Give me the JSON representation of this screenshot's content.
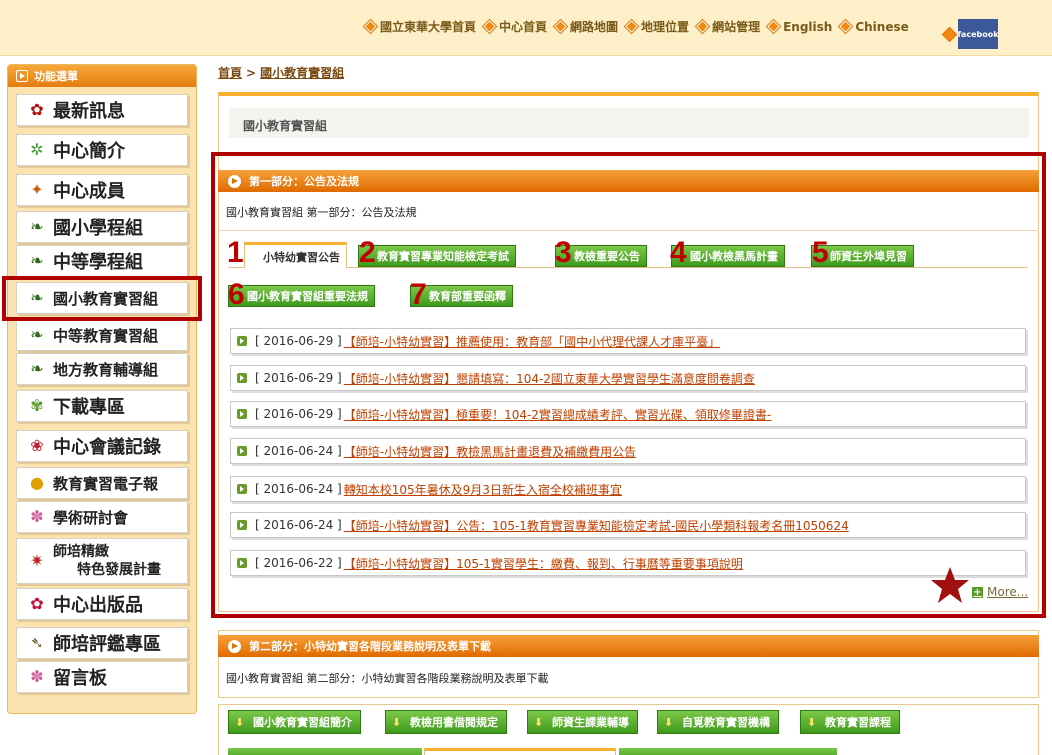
{
  "topbar": {
    "links": [
      "國立東華大學首頁",
      "中心首頁",
      "網路地圖",
      "地理位置",
      "網站管理",
      "English",
      "Chinese"
    ],
    "facebook_label": "facebook"
  },
  "sidebar": {
    "header": "功能選單",
    "items": [
      {
        "label": "最新訊息",
        "icon": "red-flower-icon"
      },
      {
        "label": "中心簡介",
        "icon": "green-flower-icon"
      },
      {
        "label": "中心成員",
        "icon": "bird-of-paradise-icon"
      },
      {
        "label": "國小學程組",
        "icon": "leaf-icon"
      },
      {
        "label": "中等學程組",
        "icon": "leaf-icon"
      },
      {
        "label": "國小教育實習組",
        "icon": "leaf-icon"
      },
      {
        "label": "中等教育實習組",
        "icon": "leaf-icon"
      },
      {
        "label": "地方教育輔導組",
        "icon": "leaf-icon"
      },
      {
        "label": "下載專區",
        "icon": "fern-icon"
      },
      {
        "label": "中心會議記錄",
        "icon": "red-blossom-icon"
      },
      {
        "label": "教育實習電子報",
        "icon": "sunflower-icon"
      },
      {
        "label": "學術研討會",
        "icon": "pink-flower-icon"
      },
      {
        "label_line1": "師培精緻",
        "label_line2": "特色發展計畫",
        "icon": "star-flower-icon"
      },
      {
        "label": "中心出版品",
        "icon": "rose-icon"
      },
      {
        "label": "師培評鑑專區",
        "icon": "branch-icon"
      },
      {
        "label": "留言板",
        "icon": "pink-flower-icon"
      }
    ]
  },
  "breadcrumb": {
    "home": "首頁",
    "separator": ">",
    "current": "國小教育實習組"
  },
  "page_title": "國小教育實習組",
  "part1": {
    "header": "第一部分：公告及法規",
    "description": "國小教育實習組 第一部分：公告及法規",
    "tabs": [
      {
        "num": "1",
        "label": "小特幼實習公告"
      },
      {
        "num": "2",
        "label": "教育實習專業知能檢定考試"
      },
      {
        "num": "3",
        "label": "教檢重要公告"
      },
      {
        "num": "4",
        "label": "國小教檢黑馬計畫"
      },
      {
        "num": "5",
        "label": "師資生外埠見習"
      },
      {
        "num": "6",
        "label": "國小教育實習組重要法規"
      },
      {
        "num": "7",
        "label": "教育部重要函釋"
      }
    ],
    "news": [
      {
        "date": "[ 2016-06-29 ]",
        "title": "【師培-小特幼實習】推薦使用：教育部「國中小代理代課人才庫平臺」"
      },
      {
        "date": "[ 2016-06-29 ]",
        "title": "【師培-小特幼實習】懇請填寫：104-2國立東華大學實習學生滿意度問卷調查"
      },
      {
        "date": "[ 2016-06-29 ]",
        "title": "【師培-小特幼實習】極重要！104-2實習總成績考評、實習光碟、領取修畢證書-"
      },
      {
        "date": "[ 2016-06-24 ]",
        "title": "【師培-小特幼實習】教檢黑馬計畫退費及補繳費用公告"
      },
      {
        "date": "[ 2016-06-24 ]",
        "title": "轉知本校105年暑休及9月3日新生入宿全校補班事宜"
      },
      {
        "date": "[ 2016-06-24 ]",
        "title": "【師培-小特幼實習】公告：105-1教育實習專業知能檢定考試-國民小學類科報考名冊1050624"
      },
      {
        "date": "[ 2016-06-22 ]",
        "title": "【師培-小特幼實習】105-1實習學生：繳費、報到、行事曆等重要事項說明"
      }
    ],
    "more_label": "More..."
  },
  "part2": {
    "header": "第二部分：小特幼實習各階段業務說明及表單下載",
    "description": "國小教育實習組 第二部分：小特幼實習各階段業務說明及表單下載",
    "tabs": [
      "國小教育實習組簡介",
      "教檢用書借閱規定",
      "師資生課業輔導",
      "自覓教育實習機構",
      "教育實習課程"
    ]
  },
  "colors": {
    "highlight": "#b00000",
    "tab_green": "#3e9a1c",
    "header_orange": "#e06a00",
    "link": "#c04000"
  }
}
